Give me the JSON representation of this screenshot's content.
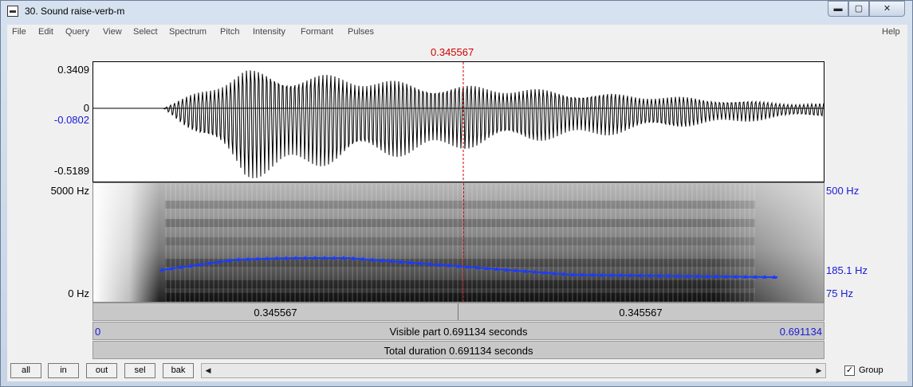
{
  "window": {
    "title": "30. Sound raise-verb-m",
    "controls": {
      "minimize": "▬",
      "maximize": "▢",
      "close": "✕"
    }
  },
  "menu": [
    "File",
    "Edit",
    "Query",
    "View",
    "Select",
    "Spectrum",
    "Pitch",
    "Intensity",
    "Formant",
    "Pulses"
  ],
  "help": "Help",
  "cursor": {
    "time_label": "0.345567",
    "time": 0.345567
  },
  "waveform": {
    "y_max": "0.3409",
    "zero": "0",
    "cursor_value": "-0.0802",
    "y_min": "-0.5189"
  },
  "spectrogram": {
    "freq_top": "5000 Hz",
    "freq_bottom": "0 Hz",
    "pitch_top": "500 Hz",
    "pitch_value": "185.1 Hz",
    "pitch_bottom": "75 Hz",
    "pitch_color": "#1a3cff"
  },
  "selection_bar": {
    "left": "0.345567",
    "right": "0.345567"
  },
  "visible_bar": {
    "start": "0",
    "label": "Visible part 0.691134 seconds",
    "end": "0.691134"
  },
  "total_bar": {
    "label": "Total duration 0.691134 seconds"
  },
  "zoom_buttons": [
    "all",
    "in",
    "out",
    "sel",
    "bak"
  ],
  "scroll": {
    "left_arrow": "◀",
    "right_arrow": "▶"
  },
  "group": {
    "label": "Group",
    "checked": true,
    "mark": "✓"
  }
}
